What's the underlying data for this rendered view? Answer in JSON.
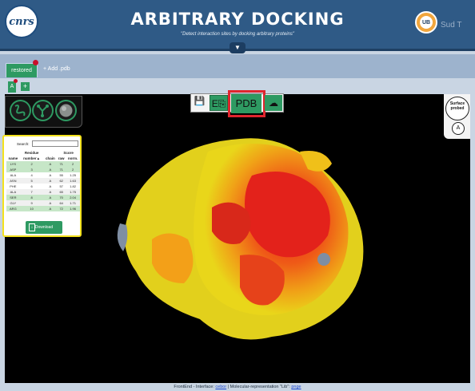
{
  "header": {
    "logo_text": "cnrs",
    "title": "ARBITRARY DOCKING",
    "subtitle": "\"Detect interaction sites by docking arbitrary proteins\"",
    "partner_logo_text": "UB",
    "partner_text": "Sud T",
    "collapse_icon": "chevron-down-icon"
  },
  "tabs": [
    {
      "label": "restored",
      "active": true
    }
  ],
  "add_pdb_label": "+ Add .pdb",
  "chains": {
    "active": "A",
    "add_label": "+"
  },
  "toolbar": {
    "save_icon": "floppy-disk-icon",
    "export_label": "E⎘",
    "pdb_label": "PDB",
    "cloud_icon": "cloud-upload-icon",
    "highlight_color": "#e0262e"
  },
  "representations": [
    "ribbon-icon",
    "ball-stick-icon",
    "surface-icon"
  ],
  "probe": {
    "label_line1": "Surface",
    "label_line2": "probed",
    "chain": "A"
  },
  "residue_table": {
    "search_label": "Search:",
    "group_headers": {
      "residue": "Residue",
      "score": "Score"
    },
    "columns": [
      "name",
      "number▲",
      "chain",
      "raw",
      "norm."
    ],
    "rows": [
      {
        "name": "LYS",
        "number": "2",
        "chain": "A",
        "raw": "71",
        "norm": "2",
        "highlight": true
      },
      {
        "name": "ASP",
        "number": "3",
        "chain": "A",
        "raw": "71",
        "norm": "2",
        "highlight": true
      },
      {
        "name": "ALA",
        "number": "4",
        "chain": "A",
        "raw": "55",
        "norm": "1.25",
        "highlight": false
      },
      {
        "name": "ASN",
        "number": "5",
        "chain": "A",
        "raw": "62",
        "norm": "1.63",
        "highlight": false
      },
      {
        "name": "PHE",
        "number": "6",
        "chain": "A",
        "raw": "57",
        "norm": "1.82",
        "highlight": false
      },
      {
        "name": "ALA",
        "number": "7",
        "chain": "A",
        "raw": "65",
        "norm": "1.75",
        "highlight": false
      },
      {
        "name": "SER",
        "number": "8",
        "chain": "A",
        "raw": "70",
        "norm": "2.04",
        "highlight": true
      },
      {
        "name": "GLY",
        "number": "9",
        "chain": "A",
        "raw": "64",
        "norm": "1.71",
        "highlight": false
      },
      {
        "name": "ARG",
        "number": "10",
        "chain": "A",
        "raw": "72",
        "norm": "1.96",
        "highlight": true
      }
    ],
    "download_label": "Download",
    "highlight_color": "#c6e6c7",
    "panel_border_color": "#f3e11d"
  },
  "footer": {
    "prefix": "FrontEnd - Interface:",
    "link1": "cebor",
    "middle": "| Molecular-representation \"Lib\":",
    "link2": "pnge"
  },
  "colors": {
    "header_bg": "#2f5a86",
    "accent_green": "#2e9a62",
    "viewer_bg": "#000000"
  }
}
